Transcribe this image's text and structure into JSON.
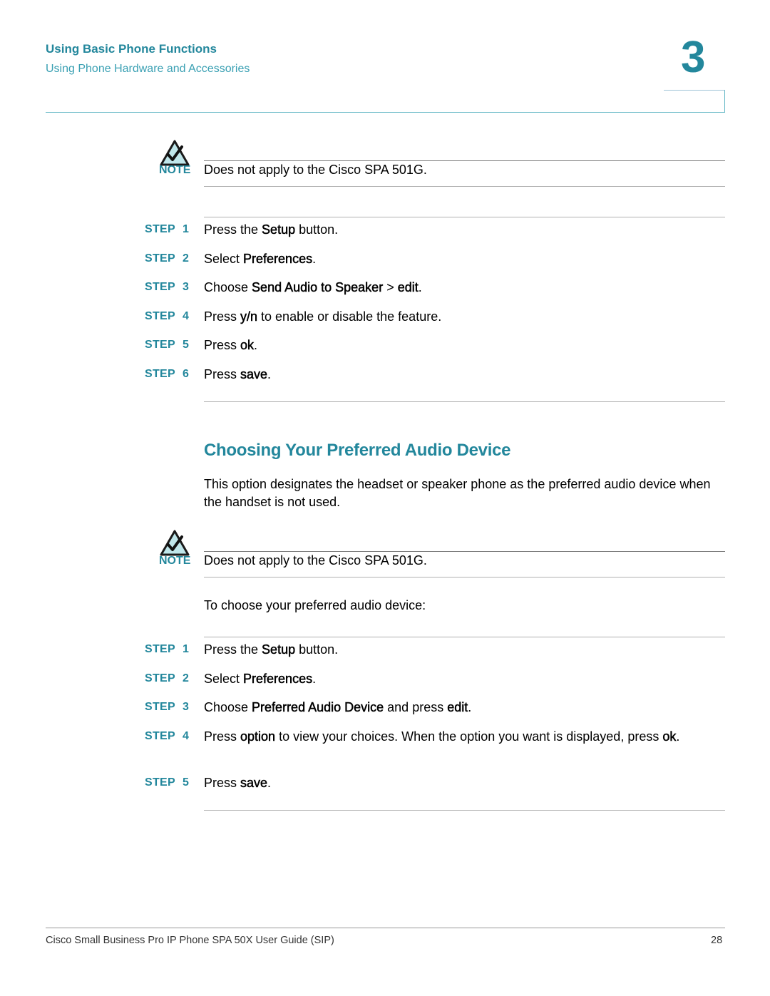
{
  "header": {
    "chapter_title": "Using Basic Phone Functions",
    "section_subtitle": "Using Phone Hardware and Accessories",
    "chapter_number": "3"
  },
  "colors": {
    "accent": "#23879c",
    "accent_light": "#3aa0b3",
    "icon_fill": "#bfe6ea"
  },
  "note1": {
    "icon": "note-checkmark-icon",
    "label": "NOTE",
    "text": "Does not apply to the Cisco SPA 501G."
  },
  "steps1": [
    {
      "label": "STEP",
      "num": "1",
      "parts": [
        {
          "t": "Press the "
        },
        {
          "t": "Setup",
          "b": true
        },
        {
          "t": " button."
        }
      ]
    },
    {
      "label": "STEP",
      "num": "2",
      "parts": [
        {
          "t": "Select "
        },
        {
          "t": "Preferences",
          "b": true
        },
        {
          "t": "."
        }
      ]
    },
    {
      "label": "STEP",
      "num": "3",
      "parts": [
        {
          "t": "Choose "
        },
        {
          "t": "Send Audio to Speaker",
          "b": true
        },
        {
          "t": " > "
        },
        {
          "t": "edit",
          "b": true
        },
        {
          "t": "."
        }
      ]
    },
    {
      "label": "STEP",
      "num": "4",
      "parts": [
        {
          "t": "Press "
        },
        {
          "t": "y/n",
          "b": true
        },
        {
          "t": " to enable or disable the feature."
        }
      ]
    },
    {
      "label": "STEP",
      "num": "5",
      "parts": [
        {
          "t": "Press "
        },
        {
          "t": "ok",
          "b": true
        },
        {
          "t": "."
        }
      ]
    },
    {
      "label": "STEP",
      "num": "6",
      "parts": [
        {
          "t": "Press "
        },
        {
          "t": "save",
          "b": true
        },
        {
          "t": "."
        }
      ]
    }
  ],
  "section": {
    "title": "Choosing Your Preferred Audio Device",
    "intro": "This option designates the headset or speaker phone as the preferred audio device when the handset is not used."
  },
  "note2": {
    "icon": "note-checkmark-icon",
    "label": "NOTE",
    "text": "Does not apply to the Cisco SPA 501G."
  },
  "lead_in": "To choose your preferred audio device:",
  "steps2": [
    {
      "label": "STEP",
      "num": "1",
      "parts": [
        {
          "t": "Press the "
        },
        {
          "t": "Setup",
          "b": true
        },
        {
          "t": " button."
        }
      ]
    },
    {
      "label": "STEP",
      "num": "2",
      "parts": [
        {
          "t": "Select "
        },
        {
          "t": "Preferences",
          "b": true
        },
        {
          "t": "."
        }
      ]
    },
    {
      "label": "STEP",
      "num": "3",
      "parts": [
        {
          "t": "Choose "
        },
        {
          "t": "Preferred Audio Device",
          "b": true
        },
        {
          "t": " and press "
        },
        {
          "t": "edit",
          "b": true
        },
        {
          "t": "."
        }
      ]
    },
    {
      "label": "STEP",
      "num": "4",
      "parts": [
        {
          "t": "Press "
        },
        {
          "t": "option",
          "b": true
        },
        {
          "t": " to view your choices. When the option you want is displayed, press "
        },
        {
          "t": "ok",
          "b": true
        },
        {
          "t": "."
        }
      ]
    },
    {
      "label": "STEP",
      "num": "5",
      "parts": [
        {
          "t": "Press "
        },
        {
          "t": "save",
          "b": true
        },
        {
          "t": "."
        }
      ]
    }
  ],
  "footer": {
    "doc_title": "Cisco Small Business Pro IP Phone SPA 50X User Guide (SIP)",
    "page_number": "28"
  }
}
